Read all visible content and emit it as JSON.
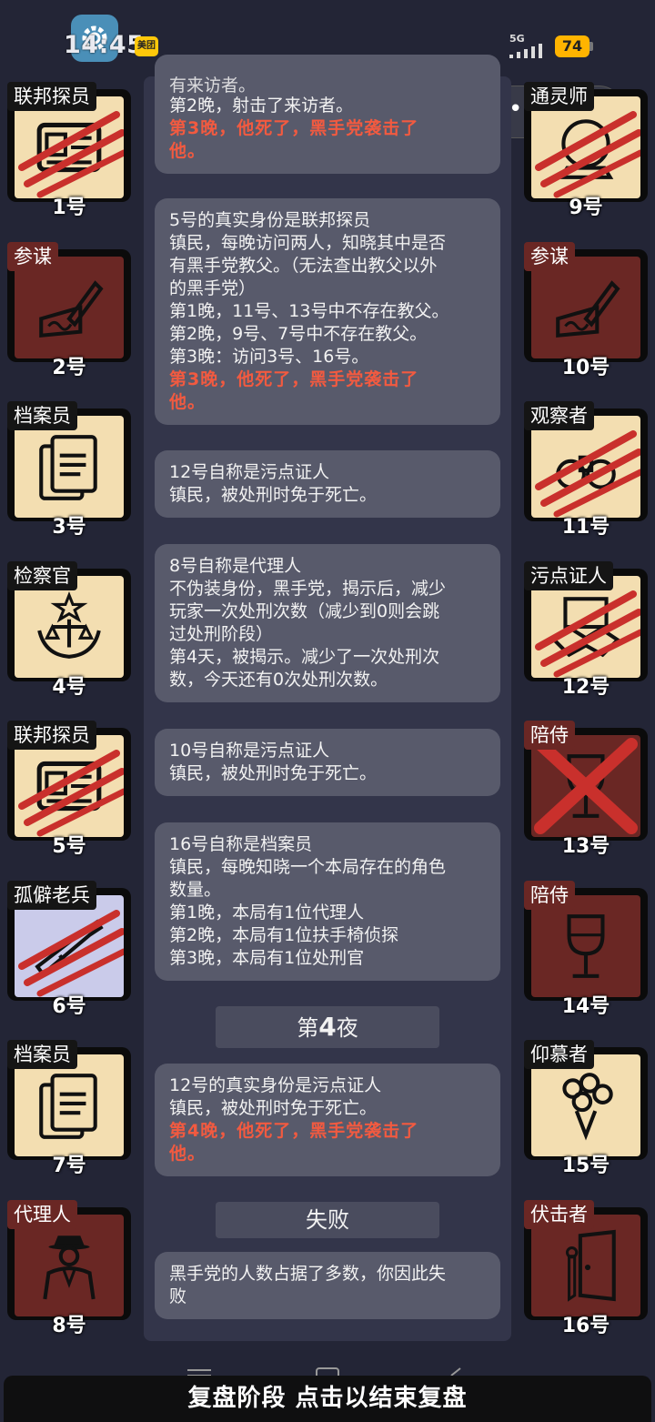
{
  "status_bar": {
    "time": "14:45",
    "app_badge": "美团",
    "network": "5G",
    "battery": "74"
  },
  "players_left": [
    {
      "role": "联邦探员",
      "number": "1号",
      "theme": "light",
      "icon": "id-card-icon",
      "dead": true
    },
    {
      "role": "参谋",
      "number": "2号",
      "theme": "dark",
      "icon": "pen-writing-icon",
      "dead": false
    },
    {
      "role": "档案员",
      "number": "3号",
      "theme": "light",
      "icon": "documents-icon",
      "dead": false
    },
    {
      "role": "检察官",
      "number": "4号",
      "theme": "light",
      "icon": "justice-emblem-icon",
      "dead": false
    },
    {
      "role": "联邦探员",
      "number": "5号",
      "theme": "light",
      "icon": "id-card-icon",
      "dead": true
    },
    {
      "role": "孤僻老兵",
      "number": "6号",
      "theme": "lav",
      "icon": "rifle-icon",
      "dead": true
    },
    {
      "role": "档案员",
      "number": "7号",
      "theme": "light",
      "icon": "documents-icon",
      "dead": false
    },
    {
      "role": "代理人",
      "number": "8号",
      "theme": "dark",
      "icon": "suited-man-icon",
      "dead": false
    }
  ],
  "players_right": [
    {
      "role": "通灵师",
      "number": "9号",
      "theme": "light",
      "icon": "crystal-ball-icon",
      "dead": true
    },
    {
      "role": "参谋",
      "number": "10号",
      "theme": "dark",
      "icon": "pen-writing-icon",
      "dead": false
    },
    {
      "role": "观察者",
      "number": "11号",
      "theme": "light",
      "icon": "binoculars-icon",
      "dead": true
    },
    {
      "role": "污点证人",
      "number": "12号",
      "theme": "light",
      "icon": "handshake-icon",
      "dead": true
    },
    {
      "role": "陪侍",
      "number": "13号",
      "theme": "dark",
      "icon": "wine-glass-icon",
      "dead": false,
      "crossed": true
    },
    {
      "role": "陪侍",
      "number": "14号",
      "theme": "dark",
      "icon": "wine-glass-icon",
      "dead": false
    },
    {
      "role": "仰慕者",
      "number": "15号",
      "theme": "light",
      "icon": "flower-bouquet-icon",
      "dead": false
    },
    {
      "role": "伏击者",
      "number": "16号",
      "theme": "dark",
      "icon": "door-knife-icon",
      "dead": false
    }
  ],
  "messages": [
    {
      "lines": [
        "有来访者。",
        "第2晚，射击了来访者。"
      ],
      "red": [
        "第3晚，他死了，黑手党袭击了",
        "他。"
      ]
    },
    {
      "lines": [
        "5号的真实身份是联邦探员",
        "镇民，每晚访问两人，知晓其中是否",
        "有黑手党教父。（无法查出教父以外",
        "的黑手党）",
        "第1晚，11号、13号中不存在教父。",
        "第2晚，9号、7号中不存在教父。",
        "第3晚：访问3号、16号。"
      ],
      "red": [
        "第3晚，他死了，黑手党袭击了",
        "他。"
      ]
    },
    {
      "lines": [
        "12号自称是污点证人",
        "镇民，被处刑时免于死亡。"
      ],
      "red": []
    },
    {
      "lines": [
        "8号自称是代理人",
        "不伪装身份，黑手党，揭示后，减少",
        "玩家一次处刑次数（减少到0则会跳",
        "过处刑阶段）",
        "第4天，被揭示。减少了一次处刑次",
        "数，今天还有0次处刑次数。"
      ],
      "red": []
    },
    {
      "lines": [
        "10号自称是污点证人",
        "镇民，被处刑时免于死亡。"
      ],
      "red": []
    },
    {
      "lines": [
        "16号自称是档案员",
        "镇民，每晚知晓一个本局存在的角色",
        "数量。",
        "第1晚，本局有1位代理人",
        "第2晚，本局有1位扶手椅侦探",
        "第3晚，本局有1位处刑官"
      ],
      "red": []
    },
    {
      "lines": [
        "12号的真实身份是污点证人",
        "镇民，被处刑时免于死亡。"
      ],
      "red": [
        "第4晚，他死了，黑手党袭击了",
        "他。"
      ]
    },
    {
      "lines": [
        "黑手党的人数占据了多数，你因此失",
        "败"
      ],
      "red": []
    }
  ],
  "phases": {
    "night_prefix": "第",
    "night_number": "4",
    "night_suffix": "夜",
    "result": "失败"
  },
  "bottom_button": "复盘阶段 点击以结束复盘",
  "colors": {
    "background": "#232536",
    "panel": "#33354a",
    "message_bg": "#585a6b",
    "death_text": "#f25a40",
    "card_light": "#f3deb1",
    "card_dark": "#6a2724",
    "scratch": "#c9302c"
  }
}
